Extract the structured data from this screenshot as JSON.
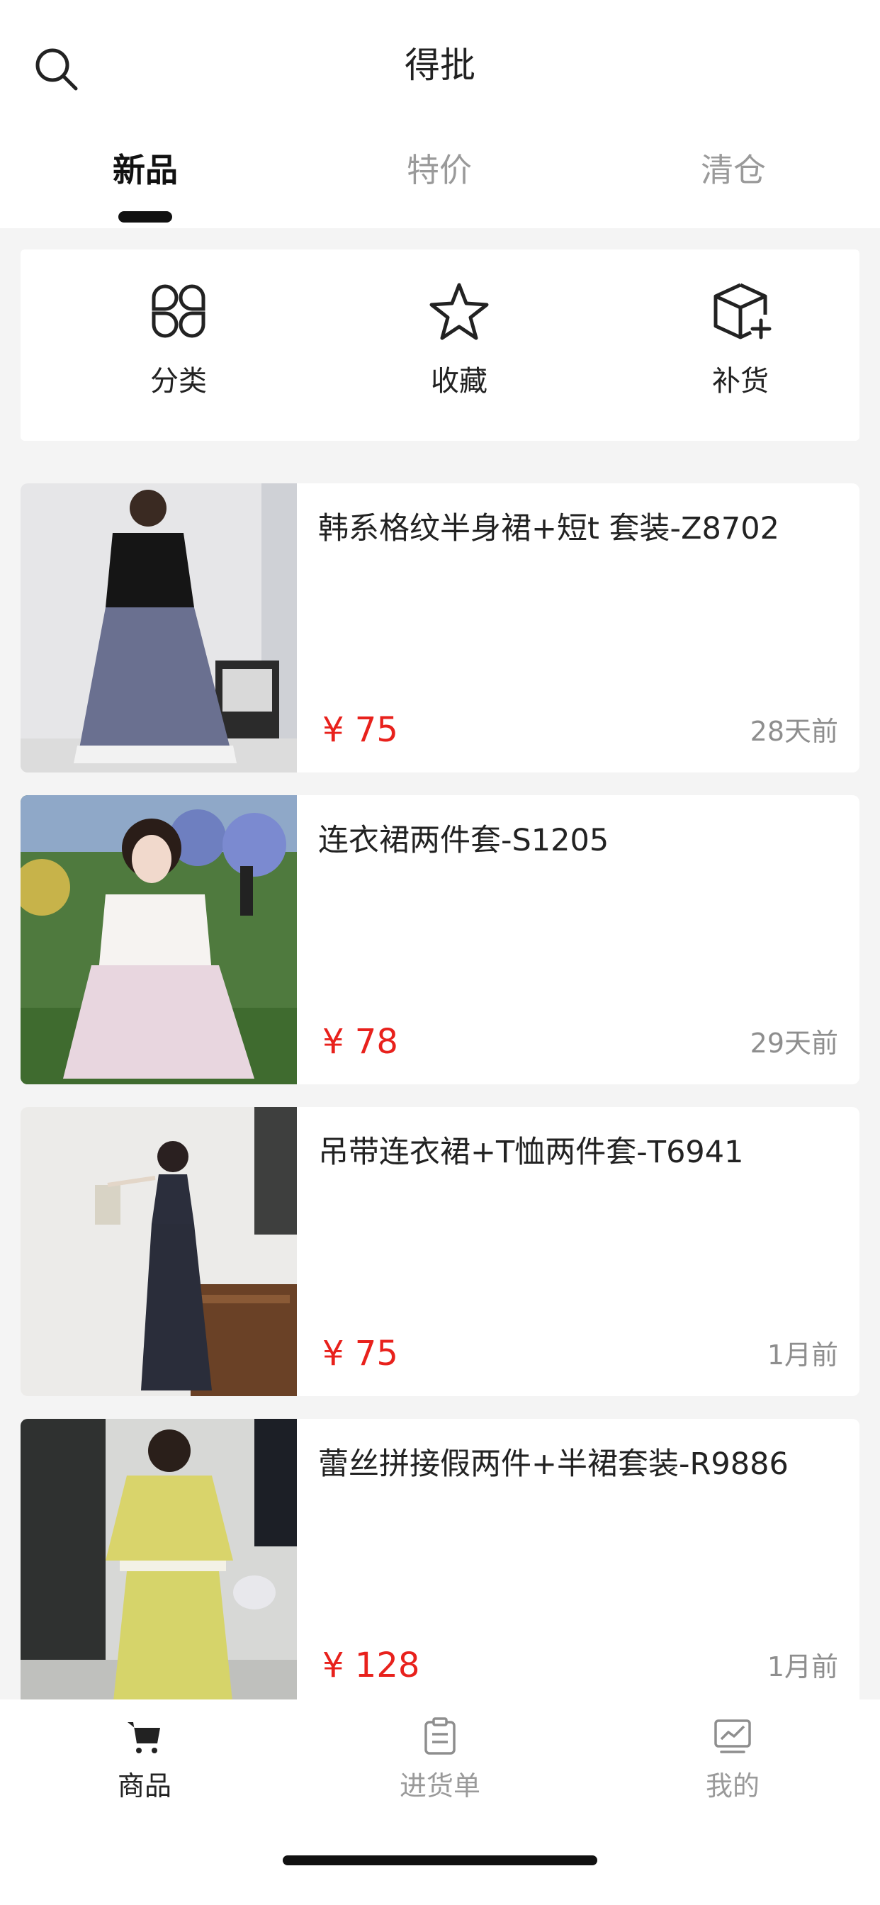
{
  "header": {
    "title": "得批",
    "search_icon": "search-icon"
  },
  "tabs": [
    {
      "label": "新品",
      "active": true
    },
    {
      "label": "特价",
      "active": false
    },
    {
      "label": "清仓",
      "active": false
    }
  ],
  "quick_actions": [
    {
      "label": "分类",
      "icon": "category-grid-icon"
    },
    {
      "label": "收藏",
      "icon": "star-icon"
    },
    {
      "label": "补货",
      "icon": "box-add-icon"
    }
  ],
  "products": [
    {
      "name": "韩系格纹半身裙+短t 套装-Z8702",
      "price": "¥ 75",
      "time": "28天前"
    },
    {
      "name": "连衣裙两件套-S1205",
      "price": "¥ 78",
      "time": "29天前"
    },
    {
      "name": "吊带连衣裙+T恤两件套-T6941",
      "price": "¥ 75",
      "time": "1月前"
    },
    {
      "name": "蕾丝拼接假两件+半裙套装-R9886",
      "price": "¥ 128",
      "time": "1月前"
    }
  ],
  "bottom_nav": [
    {
      "label": "商品",
      "icon": "cart-icon",
      "active": true
    },
    {
      "label": "进货单",
      "icon": "clipboard-icon",
      "active": false
    },
    {
      "label": "我的",
      "icon": "chart-icon",
      "active": false
    }
  ],
  "colors": {
    "price": "#e8211c",
    "tab_active": "#111111",
    "tab_inactive": "#9a9a9a",
    "background": "#f4f4f4"
  }
}
